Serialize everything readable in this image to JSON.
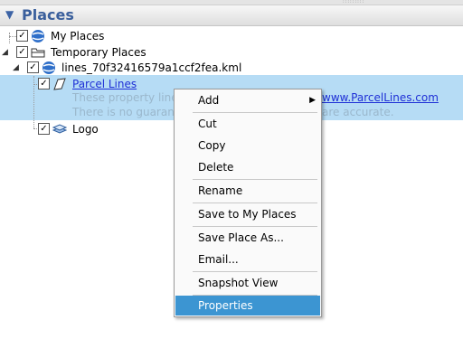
{
  "panel": {
    "title": "Places"
  },
  "tree": {
    "my_places": "My Places",
    "temporary_places": "Temporary Places",
    "kml_file": "lines_70f32416579a1ccf2fea.kml",
    "parcel_lines": "Parcel Lines",
    "desc_line1_left": "These property line",
    "desc_line1_link": "www.ParcelLines.com",
    "desc_line2_left": "There is no guarant",
    "desc_line2_right": "are accurate.",
    "logo": "Logo"
  },
  "context_menu": {
    "add": "Add",
    "cut": "Cut",
    "copy": "Copy",
    "delete": "Delete",
    "rename": "Rename",
    "save_to_my_places": "Save to My Places",
    "save_place_as": "Save Place As...",
    "email": "Email...",
    "snapshot_view": "Snapshot View",
    "properties": "Properties"
  },
  "colors": {
    "selection": "#b6dcf5",
    "menu_highlight": "#3c95d2",
    "link": "#1e2fd6",
    "header_text": "#3a5f9c"
  },
  "icons": [
    "globe-icon",
    "folder-icon",
    "kml-globe-icon",
    "polygon-icon",
    "layers-icon",
    "checkbox-icon",
    "expand-arrow-icon",
    "submenu-arrow-icon"
  ]
}
